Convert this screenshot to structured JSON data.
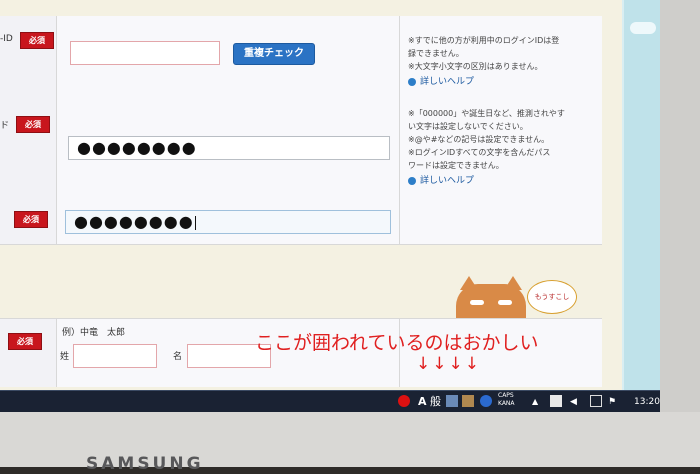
{
  "form": {
    "row1": {
      "label": "-ID",
      "required": "必須",
      "check_button": "重複チェック",
      "help": [
        "※すでに他の方が利用中のログインIDは登",
        "録できません。",
        "※大文字小文字の区別はありません。"
      ],
      "help_link": "詳しいヘルプ"
    },
    "row2": {
      "label": "ド",
      "required": "必須",
      "value": "●●●●●●●●",
      "help": [
        "※「000000」や誕生日など、推測されやす",
        "い文字は設定しないでください。",
        "※@や#などの記号は設定できません。",
        "※ログインIDすべての文字を含んだパス",
        "ワードは設定できません。"
      ],
      "help_link": "詳しいヘルプ"
    },
    "row3": {
      "required": "必須",
      "value": "●●●●●●●●"
    },
    "name_row": {
      "required": "必須",
      "example": "例）中竜　太郎",
      "last_name_label": "姓",
      "first_name_label": "名"
    }
  },
  "mascot_bubble": "もうすこし",
  "annotation": {
    "text": "ここが囲われているのはおかしい",
    "arrows": "↓↓↓↓"
  },
  "taskbar": {
    "ime_mode": "A",
    "ime_label": "般",
    "caps": "CAPS",
    "kana": "KANA",
    "clock": "13:20"
  },
  "monitor_brand": "SAMSUNG"
}
